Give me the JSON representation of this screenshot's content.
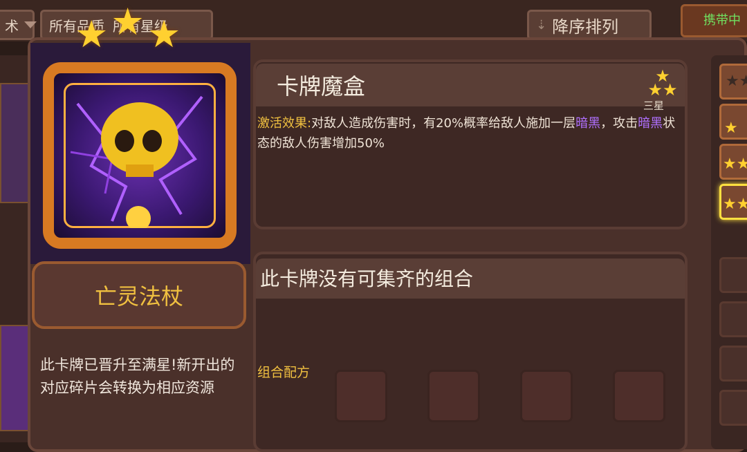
{
  "top_bar": {
    "filter_left": "术",
    "filter_rarity": "所有品质",
    "filter_stars": "所有星级",
    "sort_button": "降序排列",
    "carry_label": "携带中"
  },
  "card": {
    "name": "亡灵法杖",
    "star_count": 3,
    "max_star_note": "此卡牌已晋升至满星!新开出的对应碎片会转换为相应资源"
  },
  "info": {
    "title": "卡牌魔盒",
    "star_label": "三星",
    "effect_label": "激活效果:",
    "effect_parts": [
      {
        "text": "对敌人造成伤害时，有20%概率给敌人施加一层",
        "keyword": false
      },
      {
        "text": "暗黑",
        "keyword": true
      },
      {
        "text": "，攻击",
        "keyword": false
      },
      {
        "text": "暗黑",
        "keyword": true
      },
      {
        "text": "状态的敌人伤害增加50%",
        "keyword": false
      }
    ]
  },
  "combo": {
    "title": "此卡牌没有可集齐的组合",
    "recipe_label": "组合配方",
    "recipe_slots": 4
  },
  "colors": {
    "gold": "#f0c040",
    "dark_keyword": "#b070ff",
    "panel": "#4a302a"
  }
}
